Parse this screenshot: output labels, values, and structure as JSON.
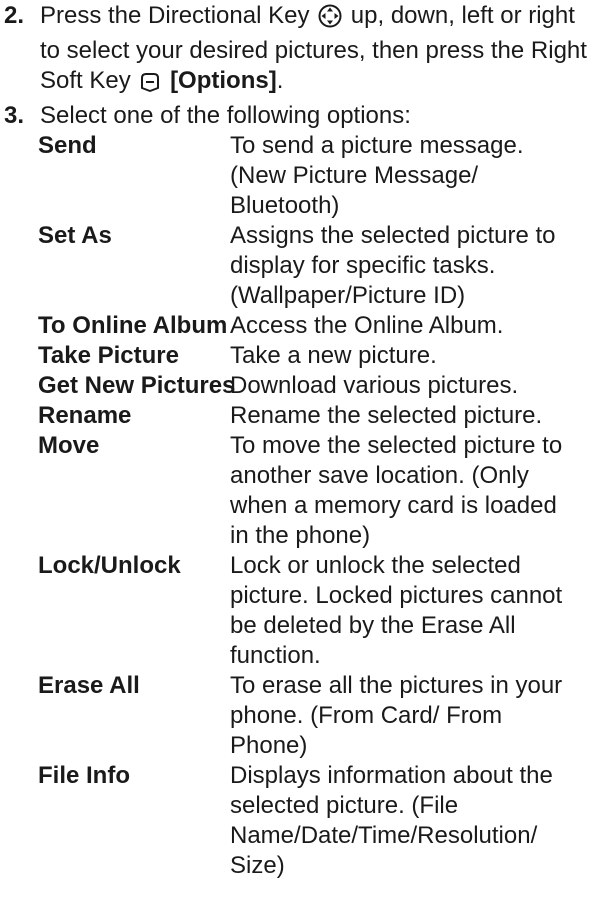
{
  "step2": {
    "number": "2.",
    "text_before_icon": "Press the Directional Key",
    "text_after_icon": "up, down, left or right to select your desired pictures, then press the Right Soft Key",
    "options_label": "[Options]",
    "end": ".",
    "directional_icon": "directional-key-icon",
    "soft_key_icon": "right-soft-key-icon"
  },
  "step3": {
    "number": "3.",
    "text": "Select one of the following options:"
  },
  "options": [
    {
      "label": "Send",
      "desc": "To send a picture message. (New Picture Message/ Bluetooth)"
    },
    {
      "label": "Set As",
      "desc": "Assigns the selected picture to display for specific tasks. (Wallpaper/Picture ID)"
    },
    {
      "label": "To Online Album",
      "desc": "Access the Online Album."
    },
    {
      "label": "Take Picture",
      "desc": "Take a new picture."
    },
    {
      "label": "Get New Pictures",
      "desc": "Download various pictures."
    },
    {
      "label": "Rename",
      "desc": "Rename the selected picture."
    },
    {
      "label": "Move",
      "desc": "To move the selected picture to another save location. (Only when a memory card is loaded in the phone)"
    },
    {
      "label": "Lock/Unlock",
      "desc": "Lock or unlock the selected picture. Locked pictures cannot be deleted by the Erase All function."
    },
    {
      "label": "Erase All",
      "desc": "To erase all the pictures in your phone. (From Card/ From Phone)"
    },
    {
      "label": "File Info",
      "desc": "Displays information about the selected picture. (File Name/Date/Time/Resolution/ Size)"
    }
  ]
}
